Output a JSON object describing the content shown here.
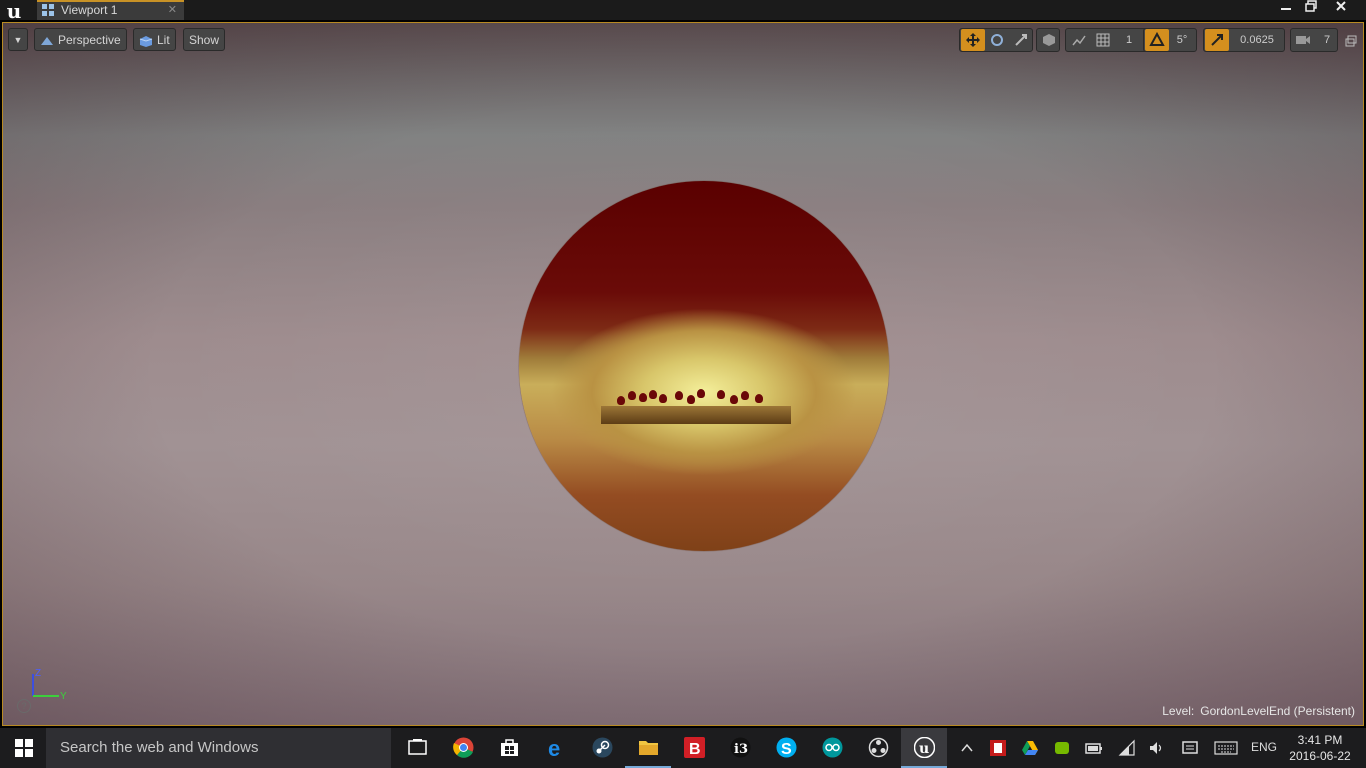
{
  "window": {
    "tab_label": "Viewport 1",
    "controls": [
      "minimize",
      "restore",
      "close"
    ]
  },
  "viewport": {
    "options_menu": "▼",
    "perspective_label": "Perspective",
    "lit_label": "Lit",
    "show_label": "Show",
    "toolbar": {
      "grid_snap_value": "1",
      "rotation_snap_value": "5°",
      "scale_snap_value": "0.0625",
      "camera_speed_value": "7"
    },
    "axis_labels": {
      "z": "Z",
      "y": "Y"
    },
    "level_label": "Level:",
    "level_name": "GordonLevelEnd (Persistent)"
  },
  "taskbar": {
    "search_placeholder": "Search the web and Windows",
    "apps": [
      "task-view",
      "chrome",
      "store",
      "edge",
      "steam",
      "file-explorer",
      "b-app",
      "i3-app",
      "skype",
      "arduino",
      "obs",
      "unreal-engine"
    ],
    "language": "ENG",
    "time": "3:41 PM",
    "date": "2016-06-22"
  },
  "colors": {
    "accent": "#c89226",
    "sky_top": "#5d5052",
    "sky_mid": "#a19294",
    "sphere_top": "#5a0000",
    "sphere_glow": "#f4ef9a"
  }
}
